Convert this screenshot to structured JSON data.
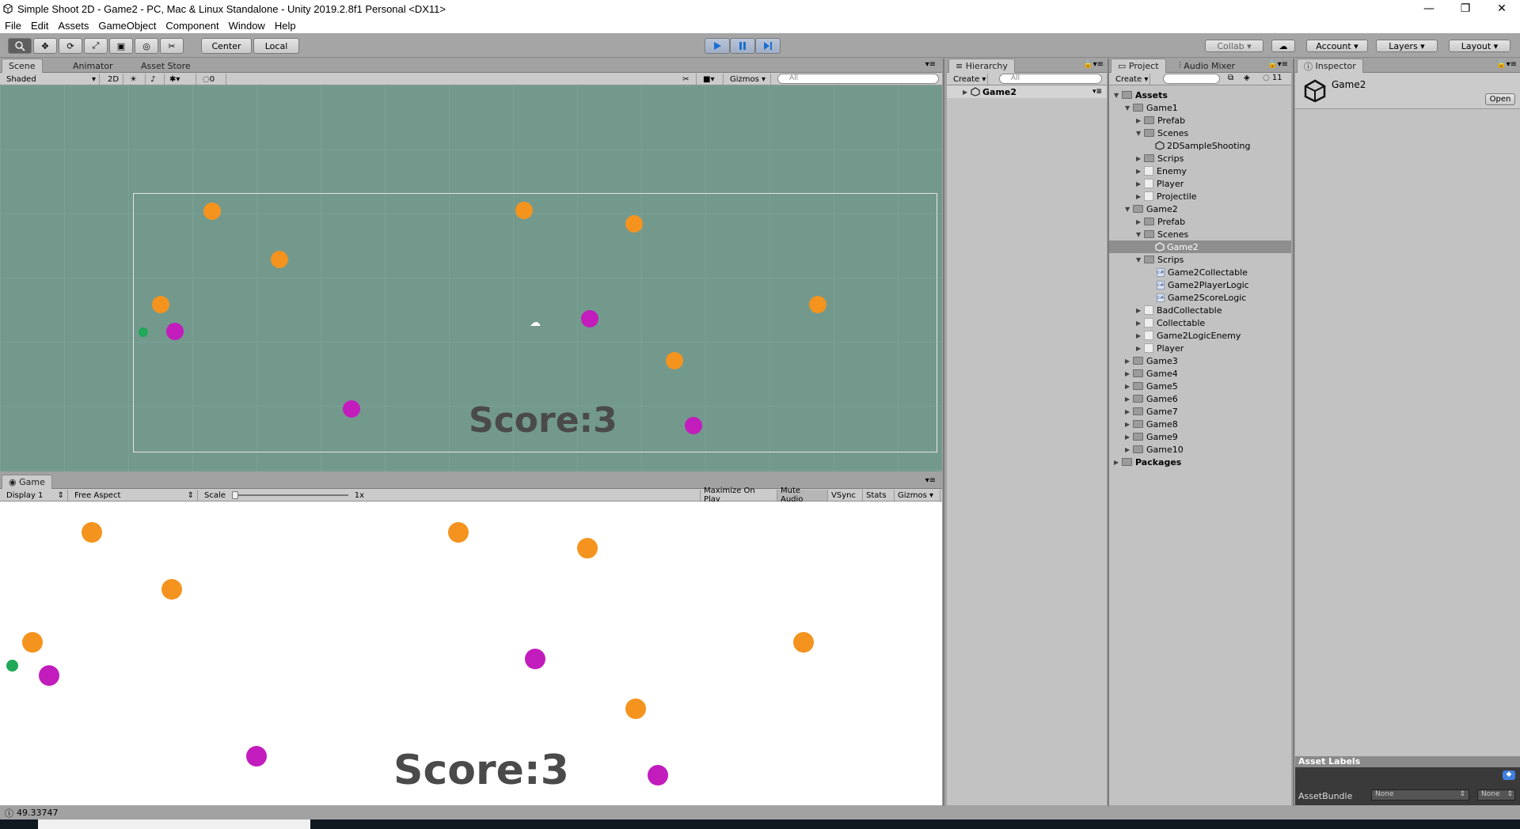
{
  "window": {
    "title": "Simple Shoot 2D - Game2 - PC, Mac & Linux Standalone - Unity 2019.2.8f1 Personal <DX11>",
    "min": "—",
    "max": "❐",
    "close": "✕"
  },
  "menu": [
    "File",
    "Edit",
    "Assets",
    "GameObject",
    "Component",
    "Window",
    "Help"
  ],
  "toolbar": {
    "pivot": "Center",
    "space": "Local",
    "collab": "Collab ▾",
    "account": "Account",
    "layers": "Layers",
    "layout": "Layout"
  },
  "scene_panel": {
    "tabs": [
      "Scene",
      "Animator",
      "Asset Store"
    ],
    "shading": "Shaded",
    "mode_2d": "2D",
    "hidden_count": "0",
    "gizmos": "Gizmos",
    "search_placeholder": "All",
    "score_text": "Score:3"
  },
  "game_panel": {
    "tab": "Game",
    "display": "Display 1",
    "aspect": "Free Aspect",
    "scale_label": "Scale",
    "scale_value": "1x",
    "maximize_on_play": "Maximize On Play",
    "mute_audio": "Mute Audio",
    "vsync": "VSync",
    "stats": "Stats",
    "gizmos": "Gizmos",
    "score_text": "Score:3"
  },
  "hierarchy": {
    "tab": "Hierarchy",
    "create": "Create",
    "search_placeholder": "All",
    "root": "Game2"
  },
  "project": {
    "tabs": [
      "Project",
      "Audio Mixer"
    ],
    "create": "Create",
    "hidden_count": "11",
    "tree": [
      {
        "label": "Assets",
        "type": "folder",
        "bold": true
      },
      {
        "label": "Game1",
        "type": "folder"
      },
      {
        "label": "Prefab",
        "type": "folder"
      },
      {
        "label": "Scenes",
        "type": "folder"
      },
      {
        "label": "2DSampleShooting",
        "type": "scene"
      },
      {
        "label": "Scrips",
        "type": "folder"
      },
      {
        "label": "Enemy",
        "type": "blank"
      },
      {
        "label": "Player",
        "type": "blank"
      },
      {
        "label": "Projectile",
        "type": "blank"
      },
      {
        "label": "Game2",
        "type": "folder"
      },
      {
        "label": "Prefab",
        "type": "folder"
      },
      {
        "label": "Scenes",
        "type": "folder"
      },
      {
        "label": "Game2",
        "type": "scene",
        "selected": true
      },
      {
        "label": "Scrips",
        "type": "folder"
      },
      {
        "label": "Game2Collectable",
        "type": "cs"
      },
      {
        "label": "Game2PlayerLogic",
        "type": "cs"
      },
      {
        "label": "Game2ScoreLogic",
        "type": "cs"
      },
      {
        "label": "BadCollectable",
        "type": "blank"
      },
      {
        "label": "Collectable",
        "type": "blank"
      },
      {
        "label": "Game2LogicEnemy",
        "type": "blank"
      },
      {
        "label": "Player",
        "type": "blank"
      },
      {
        "label": "Game3",
        "type": "folder"
      },
      {
        "label": "Game4",
        "type": "folder"
      },
      {
        "label": "Game5",
        "type": "folder"
      },
      {
        "label": "Game6",
        "type": "folder"
      },
      {
        "label": "Game7",
        "type": "folder"
      },
      {
        "label": "Game8",
        "type": "folder"
      },
      {
        "label": "Game9",
        "type": "folder"
      },
      {
        "label": "Game10",
        "type": "folder"
      },
      {
        "label": "Packages",
        "type": "folder",
        "bold": true
      }
    ]
  },
  "inspector": {
    "tab": "Inspector",
    "asset_name": "Game2",
    "open": "Open",
    "asset_labels": "Asset Labels",
    "asset_bundle_label": "AssetBundle",
    "asset_bundle_value": "None",
    "asset_bundle_variant": "None"
  },
  "status": {
    "message": "49.33747"
  },
  "colors": {
    "orange_ball": "#f4931e",
    "purple_ball": "#c21cbd",
    "player": "#1fa858",
    "scene_bg": "#73998d"
  }
}
